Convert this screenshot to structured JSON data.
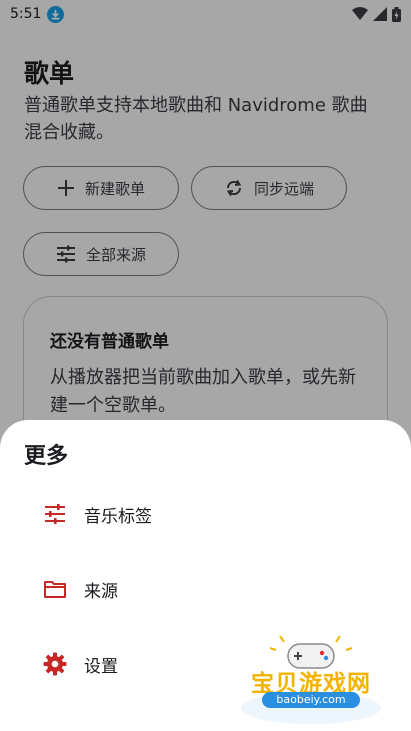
{
  "status_bar": {
    "time": "5:51"
  },
  "page": {
    "title": "歌单",
    "description": "普通歌单支持本地歌曲和 Navidrome 歌曲混合收藏。"
  },
  "actions": {
    "new_playlist": "新建歌单",
    "sync_remote": "同步远端",
    "all_sources": "全部来源"
  },
  "empty_state": {
    "title": "还没有普通歌单",
    "text": "从播放器把当前歌曲加入歌单，或先新建一个空歌单。"
  },
  "sheet": {
    "title": "更多",
    "items": [
      {
        "label": "音乐标签",
        "icon": "tune-icon"
      },
      {
        "label": "来源",
        "icon": "folder-icon"
      },
      {
        "label": "设置",
        "icon": "gear-icon"
      }
    ]
  },
  "watermark": {
    "text": "宝贝游戏网",
    "url": "baobeiy.com"
  },
  "colors": {
    "accent": "#c62828",
    "scrim": "rgba(0,0,0,0.32)"
  }
}
